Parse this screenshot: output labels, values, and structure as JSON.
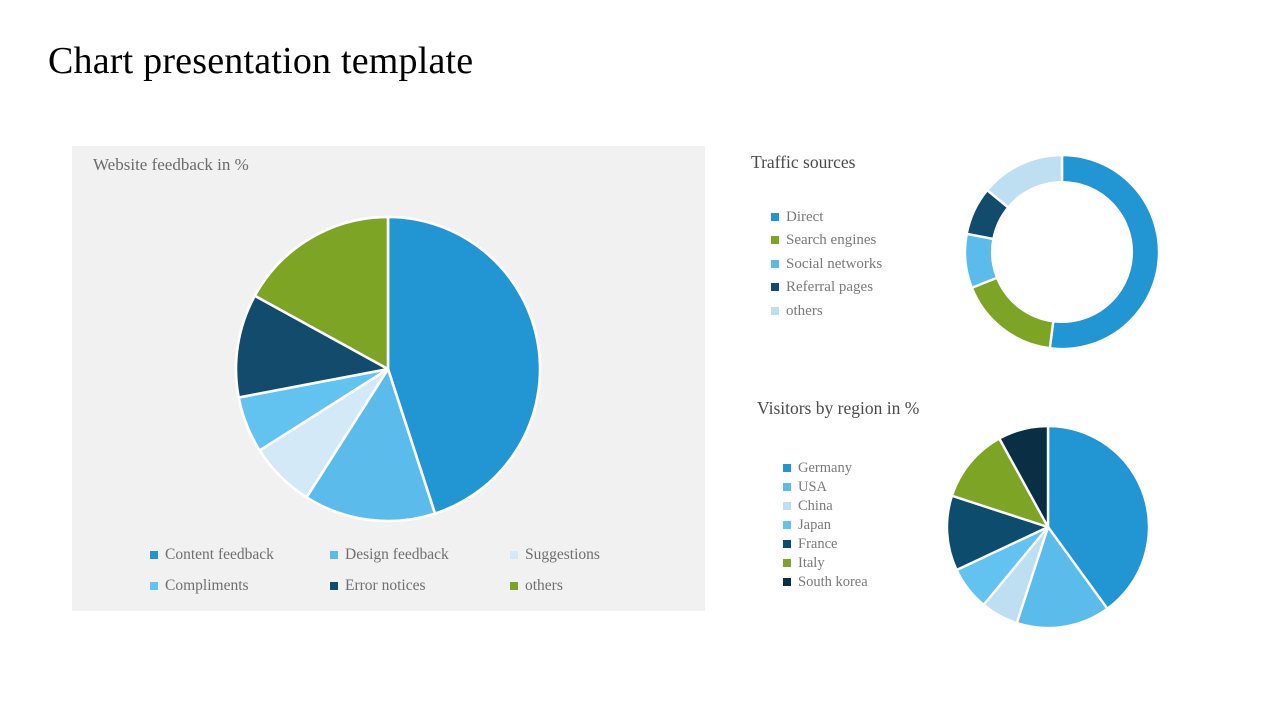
{
  "slide": {
    "title": "Chart presentation template",
    "background": "#ffffff"
  },
  "palette": {
    "blue": "#2196d3",
    "light_blue": "#5bbceb",
    "pale_blue": "#bedff2",
    "sky_blue": "#63c3f0",
    "navy": "#124b6b",
    "dark_navy": "#0a2f44",
    "steel_blue": "#0e4c6e",
    "green": "#7da425",
    "panel_bg": "#f1f1f1",
    "title_text": "#000000",
    "legend_text": "#6f6f6f",
    "heading_text": "#4a4a4a"
  },
  "left_panel": {
    "title": "Website feedback in %",
    "legend": [
      {
        "label": "Content feedback",
        "color": "#2196d3"
      },
      {
        "label": "Design feedback",
        "color": "#5bbceb"
      },
      {
        "label": "Suggestions",
        "color": "#d3e9f7"
      },
      {
        "label": "Compliments",
        "color": "#63c3f0"
      },
      {
        "label": "Error notices",
        "color": "#124b6b"
      },
      {
        "label": "others",
        "color": "#7da425"
      }
    ]
  },
  "traffic": {
    "title": "Traffic sources",
    "legend": [
      {
        "label": "Direct",
        "color": "#2196d3"
      },
      {
        "label": "Search engines",
        "color": "#7da425"
      },
      {
        "label": "Social networks",
        "color": "#5bbceb"
      },
      {
        "label": "Referral pages",
        "color": "#124b6b"
      },
      {
        "label": "others",
        "color": "#bedff2"
      }
    ]
  },
  "visitors": {
    "title": "Visitors by region in %",
    "legend": [
      {
        "label": "Germany",
        "color": "#2196d3"
      },
      {
        "label": "USA",
        "color": "#5bbceb"
      },
      {
        "label": "China",
        "color": "#bedff2"
      },
      {
        "label": "Japan",
        "color": "#63c3f0"
      },
      {
        "label": "France",
        "color": "#0e4c6e"
      },
      {
        "label": "Italy",
        "color": "#7da425"
      },
      {
        "label": "South korea",
        "color": "#0a2f44"
      }
    ]
  },
  "chart_data": [
    {
      "id": "website-feedback",
      "type": "pie",
      "title": "Website feedback in %",
      "start_angle": 0,
      "direction": "clockwise",
      "categories": [
        "Content feedback",
        "Design feedback",
        "Suggestions",
        "Compliments",
        "Error notices",
        "others"
      ],
      "values": [
        45,
        14,
        7,
        6,
        11,
        17
      ],
      "colors": [
        "#2196d3",
        "#5bbceb",
        "#d3e9f7",
        "#63c3f0",
        "#124b6b",
        "#7da425"
      ],
      "legend_position": "bottom",
      "unit": "%"
    },
    {
      "id": "traffic-sources",
      "type": "pie",
      "variant": "donut",
      "title": "Traffic sources",
      "start_angle": 0,
      "direction": "clockwise",
      "inner_radius_ratio": 0.72,
      "categories": [
        "Direct",
        "Search engines",
        "Social networks",
        "Referral pages",
        "others"
      ],
      "values": [
        52,
        17,
        9,
        8,
        14
      ],
      "colors": [
        "#2196d3",
        "#7da425",
        "#5bbceb",
        "#124b6b",
        "#bedff2"
      ],
      "legend_position": "left"
    },
    {
      "id": "visitors-by-region",
      "type": "pie",
      "title": "Visitors by region in %",
      "start_angle": 0,
      "direction": "clockwise",
      "categories": [
        "Germany",
        "USA",
        "China",
        "Japan",
        "France",
        "Italy",
        "South korea"
      ],
      "values": [
        40,
        15,
        6,
        7,
        12,
        12,
        8
      ],
      "colors": [
        "#2196d3",
        "#5bbceb",
        "#bedff2",
        "#63c3f0",
        "#0e4c6e",
        "#7da425",
        "#0a2f44"
      ],
      "legend_position": "left",
      "unit": "%"
    }
  ]
}
